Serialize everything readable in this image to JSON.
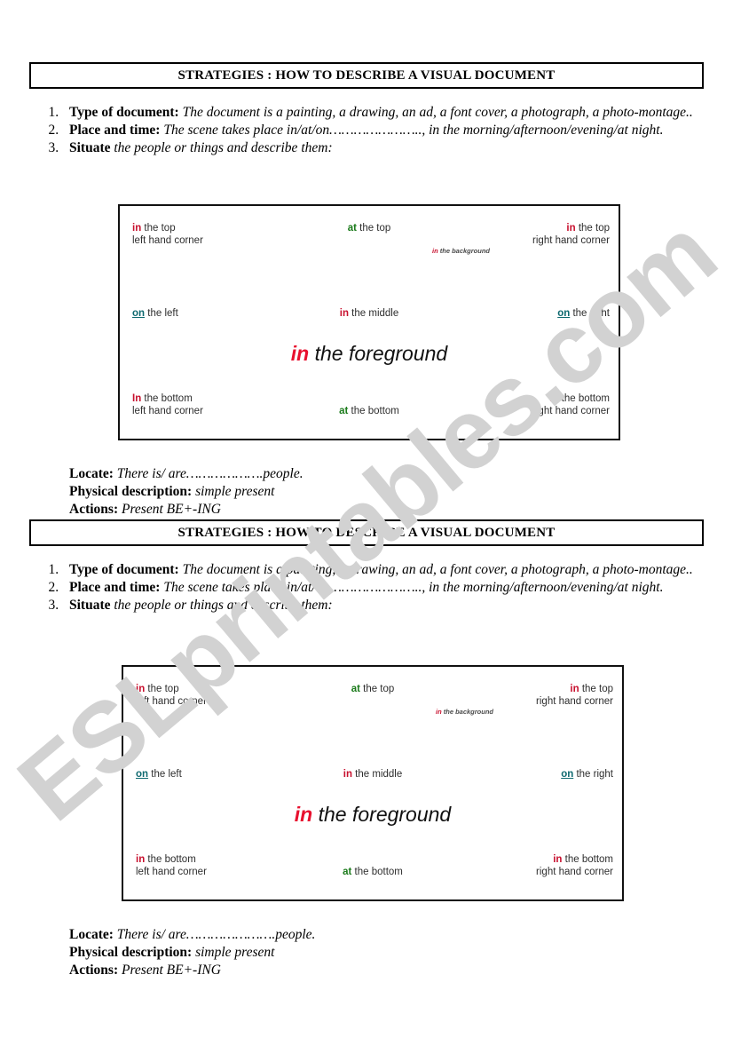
{
  "watermark": {
    "text": "ESLprintables.com"
  },
  "colors": {
    "prep_in": "#c8102e",
    "prep_at": "#1a7a1a",
    "prep_on": "#0f6a70",
    "foreground_in": "#e8102e",
    "box_border": "#111111",
    "body_text": "#2e2e2e"
  },
  "sections": [
    {
      "title": "STRATEGIES : HOW TO DESCRIBE A VISUAL DOCUMENT",
      "steps": [
        {
          "number": "1.",
          "label": "Type of document",
          "separator": ":",
          "value": " The document is a painting, a drawing, an ad, a font cover, a photograph, a photo-montage.."
        },
        {
          "number": "2.",
          "label": "Place and time:",
          "separator": "",
          "value": " The scene takes place in/at/on………………….., in the morning/afternoon/evening/at night."
        },
        {
          "number": "3.",
          "label": "Situate",
          "separator": "",
          "value": " the people or things and describe them:"
        }
      ],
      "diagram": {
        "top_left": {
          "prep": "in",
          "prep_kind": "in",
          "rest_line1": " the top",
          "rest_line2": "left hand corner"
        },
        "top_center": {
          "prep": "at",
          "prep_kind": "at",
          "rest_line1": " the top",
          "rest_line2": ""
        },
        "top_right": {
          "prep": "in",
          "prep_kind": "in",
          "rest_line1": " the top",
          "rest_line2": "right hand corner"
        },
        "background": {
          "prep": "in",
          "prep_kind": "in",
          "rest_line1": " the background",
          "rest_line2": ""
        },
        "middle_left": {
          "prep": "on",
          "prep_kind": "on",
          "rest_line1": " the left",
          "rest_line2": ""
        },
        "middle_center": {
          "prep": "in",
          "prep_kind": "in",
          "rest_line1": " the middle",
          "rest_line2": ""
        },
        "middle_right": {
          "prep": "on",
          "prep_kind": "on",
          "rest_line1": " the right",
          "rest_line2": ""
        },
        "foreground": {
          "prep": "in",
          "prep_kind": "in",
          "rest_line1": " the foreground",
          "rest_line2": ""
        },
        "bottom_left": {
          "prep": "In",
          "prep_kind": "in",
          "rest_line1": " the bottom",
          "rest_line2": "left hand corner"
        },
        "bottom_center": {
          "prep": "at",
          "prep_kind": "at",
          "rest_line1": " the bottom",
          "rest_line2": ""
        },
        "bottom_right": {
          "prep": "In",
          "prep_kind": "in",
          "rest_line1": " the bottom",
          "rest_line2": "right hand corner"
        }
      },
      "footer": {
        "locate_label": "Locate:",
        "locate_value": " There is/ are……………….people.",
        "physical_label": "Physical description:",
        "physical_value": " simple present",
        "actions_label": "Actions:",
        "actions_value": " Present BE+-ING"
      }
    },
    {
      "title": "STRATEGIES : HOW TO DESCRIBE A VISUAL DOCUMENT",
      "steps": [
        {
          "number": "1.",
          "label": "Type of document",
          "separator": ":",
          "value": " The document is a painting, a drawing, an ad, a font cover, a photograph, a photo-montage.."
        },
        {
          "number": "2.",
          "label": "Place and time:",
          "separator": "",
          "value": " The scene takes place in/at/on………………….., in the morning/afternoon/evening/at night."
        },
        {
          "number": "3.",
          "label": "Situate",
          "separator": "",
          "value": " the people or things and describe them:"
        }
      ],
      "diagram": {
        "top_left": {
          "prep": "in",
          "prep_kind": "in",
          "rest_line1": " the top",
          "rest_line2": "left hand corner"
        },
        "top_center": {
          "prep": "at",
          "prep_kind": "at",
          "rest_line1": " the top",
          "rest_line2": ""
        },
        "top_right": {
          "prep": "in",
          "prep_kind": "in",
          "rest_line1": " the top",
          "rest_line2": "right hand corner"
        },
        "background": {
          "prep": "in",
          "prep_kind": "in",
          "rest_line1": " the background",
          "rest_line2": ""
        },
        "middle_left": {
          "prep": "on",
          "prep_kind": "on",
          "rest_line1": " the left",
          "rest_line2": ""
        },
        "middle_center": {
          "prep": "in",
          "prep_kind": "in",
          "rest_line1": " the middle",
          "rest_line2": ""
        },
        "middle_right": {
          "prep": "on",
          "prep_kind": "on",
          "rest_line1": " the right",
          "rest_line2": ""
        },
        "foreground": {
          "prep": "in",
          "prep_kind": "in",
          "rest_line1": " the foreground",
          "rest_line2": ""
        },
        "bottom_left": {
          "prep": "in",
          "prep_kind": "in",
          "rest_line1": " the bottom",
          "rest_line2": "left hand corner"
        },
        "bottom_center": {
          "prep": "at",
          "prep_kind": "at",
          "rest_line1": " the bottom",
          "rest_line2": ""
        },
        "bottom_right": {
          "prep": "in",
          "prep_kind": "in",
          "rest_line1": " the bottom",
          "rest_line2": "right hand corner"
        }
      },
      "footer": {
        "locate_label": "Locate:",
        "locate_value": " There is/ are………………….people.",
        "physical_label": "Physical description:",
        "physical_value": " simple present",
        "actions_label": "Actions:",
        "actions_value": " Present BE+-ING"
      }
    }
  ]
}
